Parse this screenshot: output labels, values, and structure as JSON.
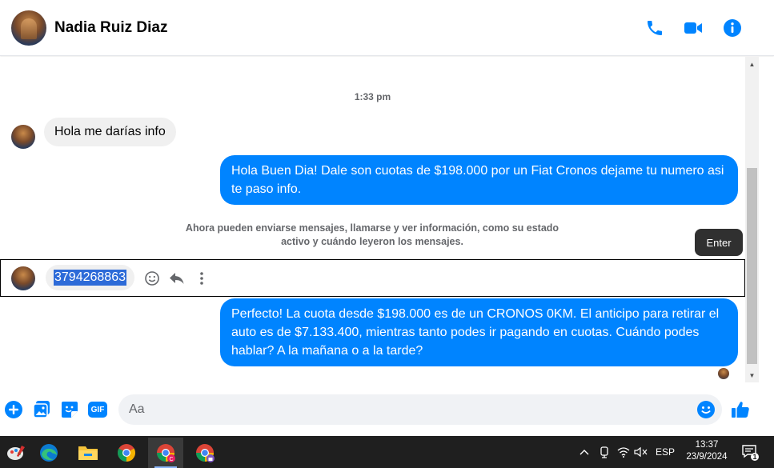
{
  "header": {
    "contact_name": "Nadia Ruiz Diaz",
    "icons": [
      "phone-icon",
      "video-camera-icon",
      "info-icon"
    ],
    "accent_color": "#0084ff"
  },
  "chat": {
    "timestamp": "1:33 pm",
    "messages": [
      {
        "direction": "incoming",
        "text": "Hola me darías info"
      },
      {
        "direction": "outgoing",
        "text": "Hola Buen Dia! Dale son cuotas de $198.000 por un Fiat Cronos dejame tu numero asi te paso info."
      },
      {
        "direction": "outgoing",
        "text": "Perfecto! La cuota desde $198.000 es de un CRONOS 0KM. El anticipo para retirar el auto es de $7.133.400, mientras tanto podes ir pagando en cuotas. Cuándo podes hablar? A la mañana o a la tarde?"
      }
    ],
    "system_note": "Ahora pueden enviarse mensajes, llamarse y ver información, como su estado activo y cuándo leyeron los mensajes.",
    "hovered_message": {
      "text": "3794268863",
      "actions": [
        "smiley-icon",
        "reply-icon",
        "more-vertical-icon"
      ]
    },
    "tooltip": "Enter"
  },
  "composer": {
    "placeholder": "Aa",
    "icons": [
      "plus-icon",
      "photo-icon",
      "sticker-icon",
      "gif-icon",
      "emoji-icon",
      "thumbs-up-icon"
    ],
    "gif_label": "GIF"
  },
  "taskbar": {
    "apps": [
      "paint-icon",
      "edge-icon",
      "file-explorer-icon",
      "chrome-icon",
      "chrome-profile-c-icon",
      "chrome-profile-lock-icon"
    ],
    "tray": {
      "language": "ESP",
      "time": "13:37",
      "date": "23/9/2024",
      "notification_count": "1"
    }
  }
}
